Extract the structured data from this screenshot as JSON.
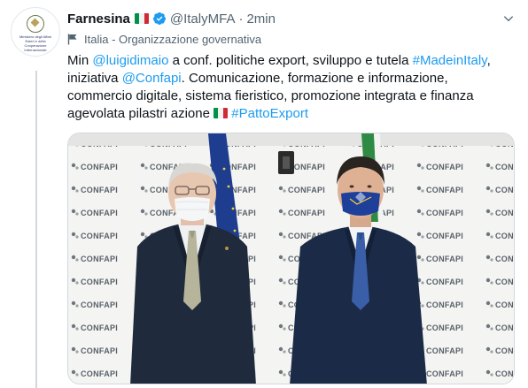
{
  "author": {
    "name": "Farnesina",
    "handle": "@ItalyMFA",
    "separator": "·",
    "time": "2min",
    "avatar_text": "Ministero degli Affari Esteri e della Cooperazione Internazionale"
  },
  "label": {
    "text": "Italia - Organizzazione governativa",
    "icon": "flag-icon"
  },
  "tweet": {
    "p1": "Min ",
    "mention1": "@luigidimaio",
    "p2": " a conf. politiche export, sviluppo e tutela ",
    "hashtag1": "#MadeinItaly",
    "p3": ", iniziativa ",
    "mention2": "@Confapi",
    "p4": ". Comunicazione, formazione e informazione, commercio digitale, sistema fieristico, promozione integrata e finanza agevolata pilastri azione ",
    "hashtag2": "#PattoExport"
  },
  "media": {
    "backdrop_logo": "CONFAPI"
  },
  "colors": {
    "link": "#1d9bf0",
    "text": "#0f1419",
    "muted": "#536471",
    "border": "#cfd9de"
  }
}
